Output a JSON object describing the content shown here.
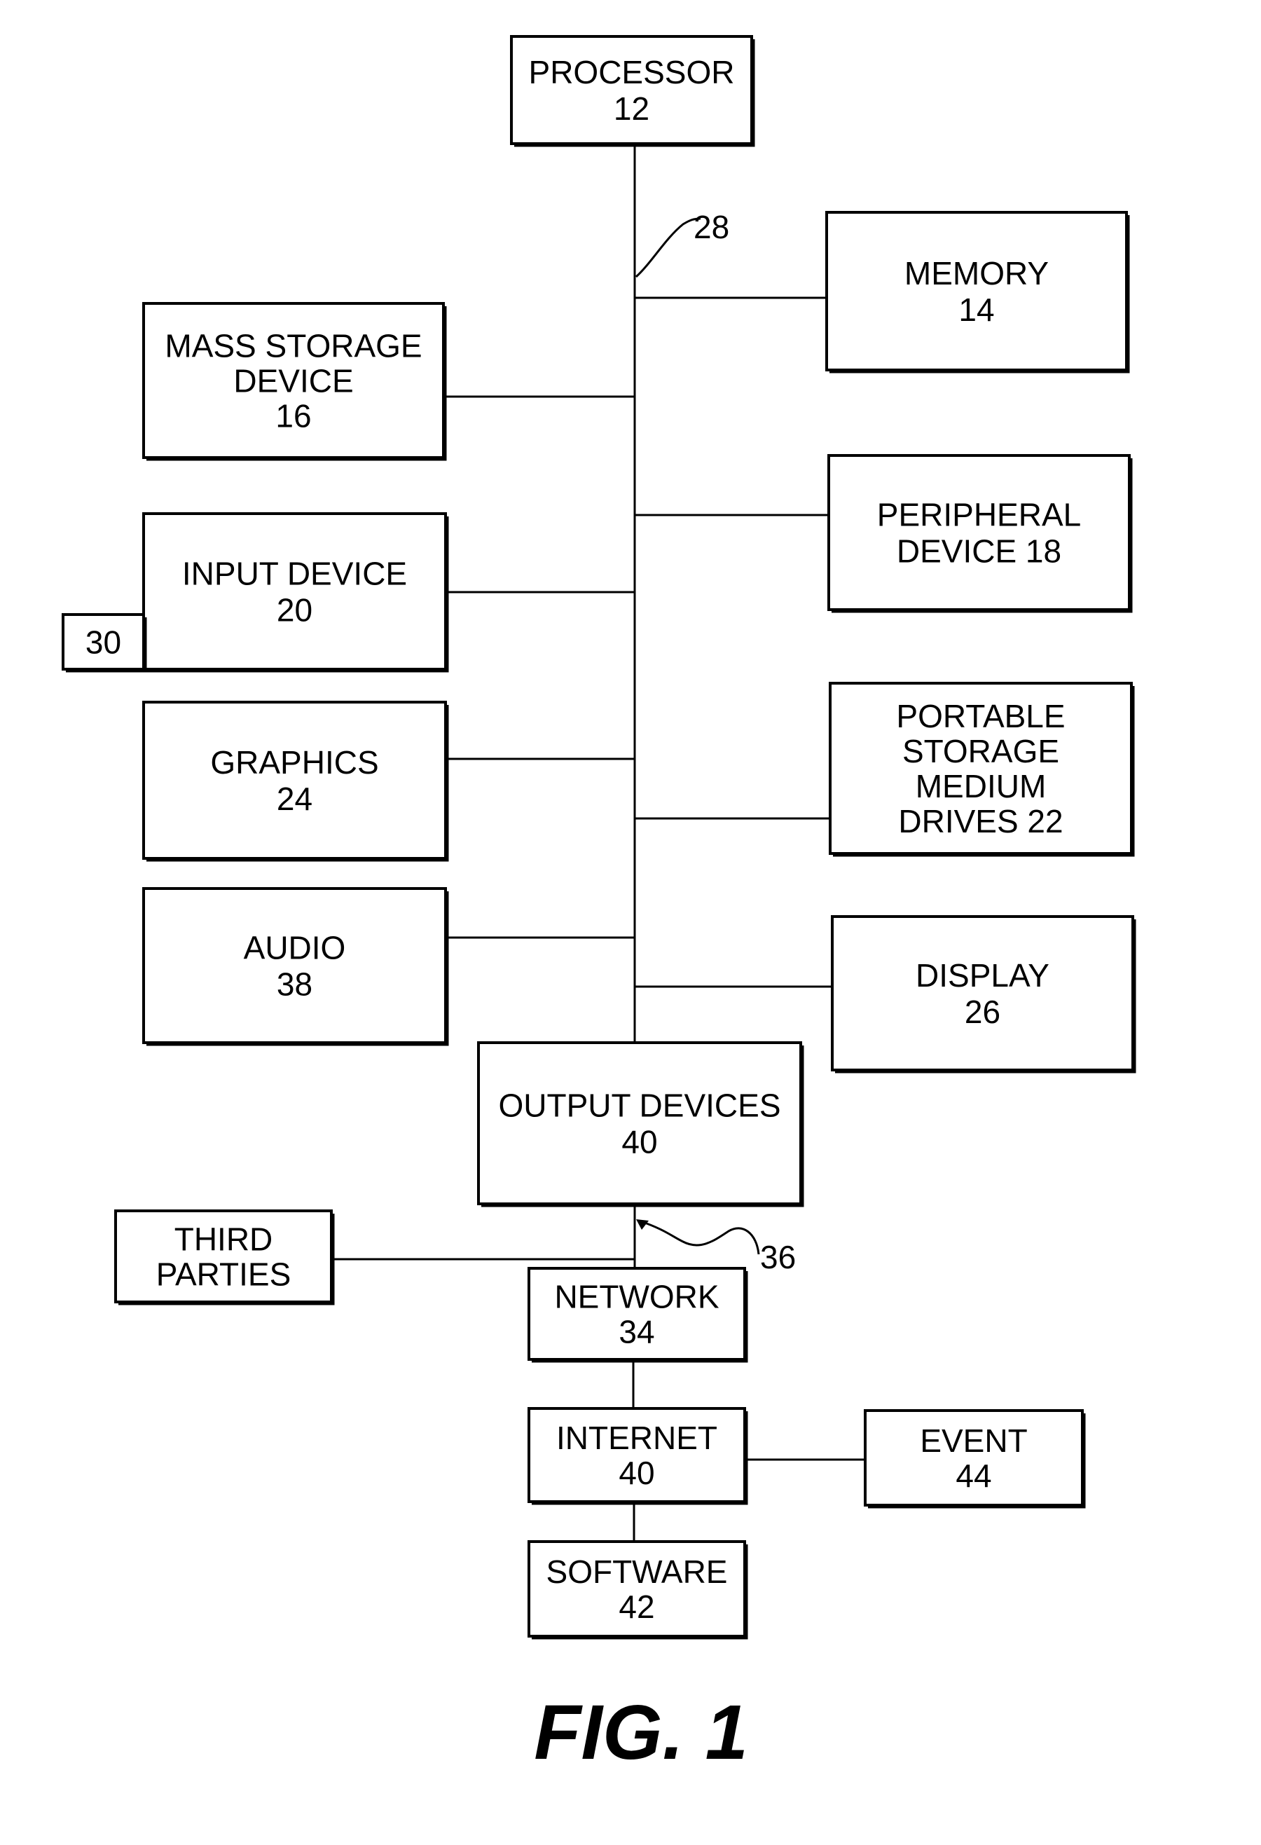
{
  "figure": {
    "caption": "FIG. 1",
    "bus_reference": "28",
    "network_link_reference": "36"
  },
  "blocks": {
    "processor": {
      "lines": [
        "PROCESSOR",
        "12"
      ]
    },
    "memory": {
      "lines": [
        "MEMORY",
        "14"
      ]
    },
    "mass_storage": {
      "lines": [
        "MASS STORAGE",
        "DEVICE",
        "16"
      ]
    },
    "peripheral": {
      "lines": [
        "PERIPHERAL",
        "DEVICE 18"
      ]
    },
    "input_device": {
      "lines": [
        "INPUT DEVICE",
        "20"
      ]
    },
    "input_accessory": {
      "lines": [
        "30"
      ]
    },
    "graphics": {
      "lines": [
        "GRAPHICS",
        "24"
      ]
    },
    "portable_storage": {
      "lines": [
        "PORTABLE",
        "STORAGE",
        "MEDIUM",
        "DRIVES 22"
      ]
    },
    "audio": {
      "lines": [
        "AUDIO",
        "38"
      ]
    },
    "display": {
      "lines": [
        "DISPLAY",
        "26"
      ]
    },
    "output_devices": {
      "lines": [
        "OUTPUT DEVICES",
        "40"
      ]
    },
    "third_parties": {
      "lines": [
        "THIRD",
        "PARTIES"
      ]
    },
    "network": {
      "lines": [
        "NETWORK",
        "34"
      ]
    },
    "internet": {
      "lines": [
        "INTERNET",
        "40"
      ]
    },
    "event": {
      "lines": [
        "EVENT",
        "44"
      ]
    },
    "software": {
      "lines": [
        "SOFTWARE",
        "42"
      ]
    }
  }
}
